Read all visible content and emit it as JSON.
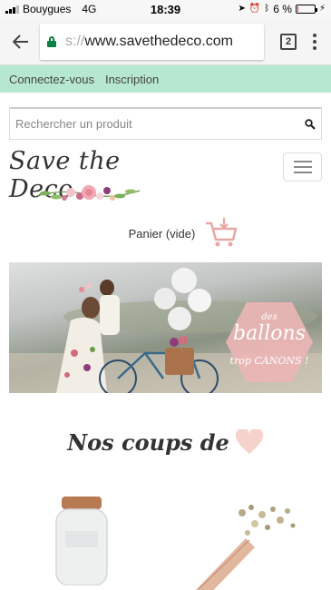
{
  "status_bar": {
    "carrier": "Bouygues",
    "network": "4G",
    "time": "18:39",
    "battery": "6 %",
    "battery_level": 0.06
  },
  "browser": {
    "url_prefix": "s://",
    "url": "www.savethedeco.com",
    "tab_count": "2"
  },
  "account_bar": {
    "login_label": "Connectez-vous",
    "register_label": "Inscription"
  },
  "search": {
    "placeholder": "Rechercher un produit"
  },
  "header": {
    "logo_text": "Save the Deco"
  },
  "cart": {
    "label": "Panier (vide)"
  },
  "banner": {
    "hex_small": "des",
    "hex_main": "ballons",
    "hex_sub": "trop CANONS !"
  },
  "section": {
    "title": "Nos coups de"
  },
  "colors": {
    "account_bar": "#b6e7d0",
    "accent_pink": "#e8a7a7",
    "battery_low": "#e0251d",
    "lock_green": "#0b8043"
  }
}
